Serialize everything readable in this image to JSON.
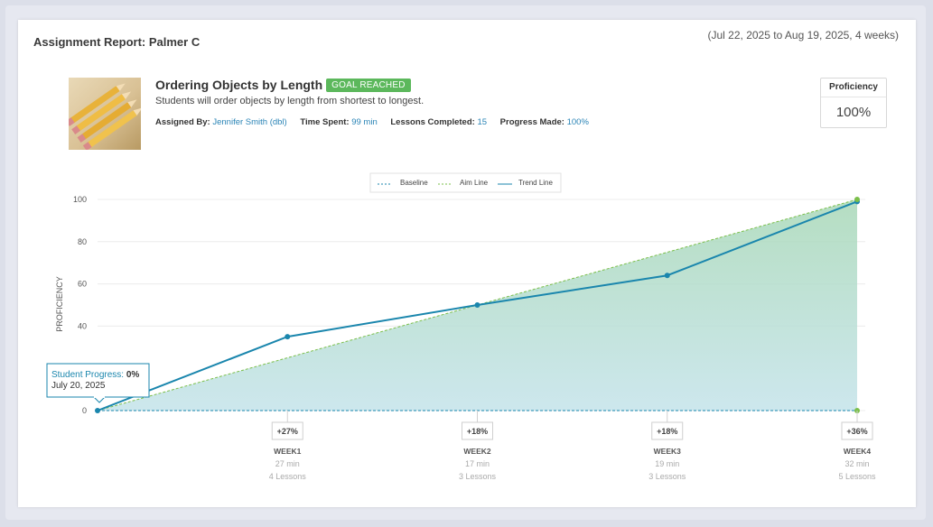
{
  "report": {
    "title": "Assignment Report: Palmer C",
    "date_range": "(Jul 22, 2025 to Aug 19, 2025, 4 weeks)"
  },
  "lesson": {
    "title": "Ordering Objects by Length",
    "badge": "GOAL REACHED",
    "description": "Students will order objects by length from shortest to longest.",
    "assigned_by_label": "Assigned By:",
    "assigned_by": "Jennifer Smith (dbl)",
    "time_spent_label": "Time Spent:",
    "time_spent": "99 min",
    "lessons_completed_label": "Lessons Completed:",
    "lessons_completed": "15",
    "progress_label": "Progress Made:",
    "progress": "100%"
  },
  "proficiency": {
    "label": "Proficiency",
    "value": "100%"
  },
  "tooltip": {
    "label": "Student Progress:",
    "value": "0%",
    "date": "July 20, 2025"
  },
  "colors": {
    "trend": "#1a86ad",
    "aim": "#7bbf4a",
    "fill_top": "#a8d8b7",
    "fill_bottom": "#c4e3ea",
    "badge": "#5cb85c",
    "link": "#2a84b6"
  },
  "chart_data": {
    "type": "line",
    "title": "",
    "ylabel": "PROFICIENCY",
    "xlabel": "",
    "ylim": [
      0,
      100
    ],
    "yticks": [
      0,
      40,
      60,
      80,
      100
    ],
    "grid": true,
    "legend": {
      "placement": "top-center",
      "entries": [
        "Baseline",
        "Aim Line",
        "Trend Line"
      ]
    },
    "x": [
      0,
      1,
      2,
      3,
      4
    ],
    "series": [
      {
        "name": "Trend Line",
        "values": [
          0,
          35,
          50,
          64,
          99
        ]
      },
      {
        "name": "Aim Line",
        "values": [
          0,
          25,
          50,
          75,
          100
        ]
      },
      {
        "name": "Baseline",
        "values": [
          0,
          0,
          0,
          0,
          0
        ]
      }
    ],
    "weeks": [
      {
        "change": "+27%",
        "label": "WEEK1",
        "minutes": "27 min",
        "lessons": "4 Lessons"
      },
      {
        "change": "+18%",
        "label": "WEEK2",
        "minutes": "17 min",
        "lessons": "3 Lessons"
      },
      {
        "change": "+18%",
        "label": "WEEK3",
        "minutes": "19 min",
        "lessons": "3 Lessons"
      },
      {
        "change": "+36%",
        "label": "WEEK4",
        "minutes": "32 min",
        "lessons": "5 Lessons"
      }
    ]
  }
}
